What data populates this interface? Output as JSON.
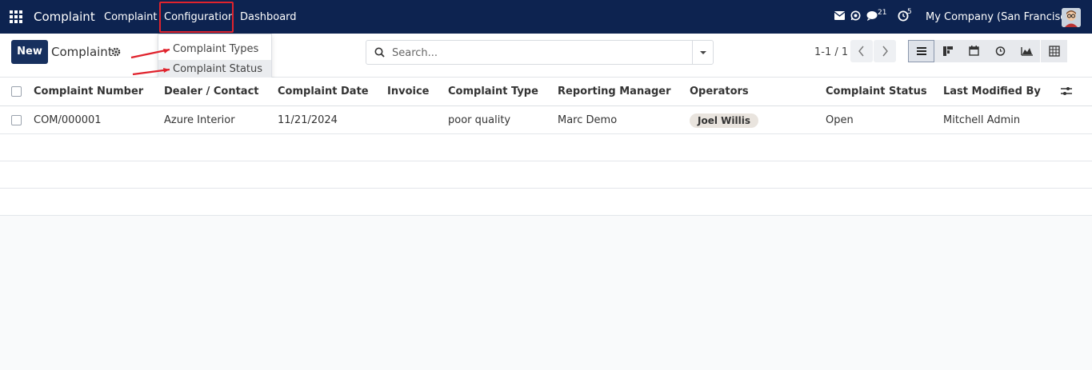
{
  "navbar": {
    "app_title": "Complaint",
    "menu": [
      "Complaint",
      "Configuration",
      "Dashboard"
    ],
    "messages_badge": "21",
    "activities_badge": "5",
    "company": "My Company (San Francisco)",
    "icons": [
      "apps-grid-icon",
      "envelope-icon",
      "whatsapp-icon",
      "chat-icon",
      "clock-icon",
      "avatar"
    ]
  },
  "control": {
    "new_label": "New",
    "breadcrumb": "Complaint",
    "search_placeholder": "Search...",
    "pager": "1-1 / 1",
    "views": [
      "list",
      "kanban",
      "calendar",
      "activity",
      "graph",
      "pivot"
    ]
  },
  "dropdown": {
    "items": [
      "Complaint Types",
      "Complaint Status"
    ]
  },
  "table": {
    "columns": [
      "Complaint Number",
      "Dealer / Contact",
      "Complaint Date",
      "Invoice",
      "Complaint Type",
      "Reporting Manager",
      "Operators",
      "Complaint Status",
      "Last Modified By"
    ],
    "rows": [
      {
        "number": "COM/000001",
        "dealer": "Azure Interior",
        "date": "11/21/2024",
        "invoice": "",
        "type": "poor quality",
        "manager": "Marc Demo",
        "operators": "Joel Willis",
        "status": "Open",
        "modified_by": "Mitchell Admin"
      }
    ]
  },
  "colors": {
    "navbar": "#0d2350",
    "primary": "#17305e",
    "highlight": "#e0232d"
  }
}
